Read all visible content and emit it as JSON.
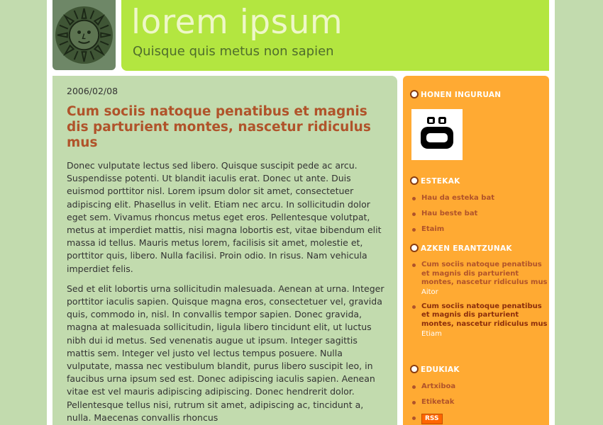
{
  "colors": {
    "background": "#c2dbae",
    "header": "#b3e640",
    "sidebar": "#ffaa33",
    "accent": "#b0532a"
  },
  "header": {
    "logo_icon": "sun-face-icon",
    "title": "lorem ipsum",
    "tagline": "Quisque quis metus non sapien"
  },
  "post": {
    "date": "2006/02/08",
    "title": "Cum sociis natoque penatibus et magnis dis parturient montes, nascetur ridiculus mus",
    "paragraphs": [
      "Donec vulputate lectus sed libero. Quisque suscipit pede ac arcu. Suspendisse potenti. Ut blandit iaculis erat. Donec ut ante. Duis euismod porttitor nisl. Lorem ipsum dolor sit amet, consectetuer adipiscing elit. Phasellus in velit. Etiam nec arcu. In sollicitudin dolor eget sem. Vivamus rhoncus metus eget eros. Pellentesque volutpat, metus at imperdiet mattis, nisi magna lobortis est, vitae bibendum elit massa id tellus. Mauris metus lorem, facilisis sit amet, molestie et, porttitor quis, libero. Nulla facilisi. Proin odio. In risus. Nam vehicula imperdiet felis.",
      "Sed et elit lobortis urna sollicitudin malesuada. Aenean at urna. Integer porttitor iaculis sapien. Quisque magna eros, consectetuer vel, gravida quis, commodo in, nisl. In convallis tempor sapien. Donec gravida, magna at malesuada sollicitudin, ligula libero tincidunt elit, ut luctus nibh dui id metus. Sed venenatis augue ut ipsum. Integer sagittis mattis sem. Integer vel justo vel lectus tempus posuere. Nulla vulputate, massa nec vestibulum blandit, purus libero suscipit leo, in faucibus urna ipsum sed est. Donec adipiscing iaculis sapien. Aenean vitae est vel mauris adipiscing adipiscing. Donec hendrerit dolor. Pellentesque tellus nisi, rutrum sit amet, adipiscing ac, tincidunt a, nulla. Maecenas convallis rhoncus"
    ]
  },
  "sidebar": {
    "about": {
      "heading": "HONEN INGURUAN",
      "avatar_icon": "robot-face-icon"
    },
    "links": {
      "heading": "ESTEKAK",
      "items": [
        "Hau da esteka bat",
        "Hau beste bat",
        "Etaim"
      ]
    },
    "comments": {
      "heading": "AZKEN ERANTZUNAK",
      "items": [
        {
          "text": "Cum sociis natoque penatibus et magnis dis parturient montes, nascetur ridiculus mus",
          "author": "Aitor"
        },
        {
          "text": "Cum sociis natoque penatibus et magnis dis parturient montes, nascetur ridiculus mus",
          "author": "Etiam"
        }
      ]
    },
    "content": {
      "heading": "EDUKIAK",
      "items": [
        "Artxiboa",
        "Etiketak"
      ],
      "rss": "RSS"
    }
  }
}
